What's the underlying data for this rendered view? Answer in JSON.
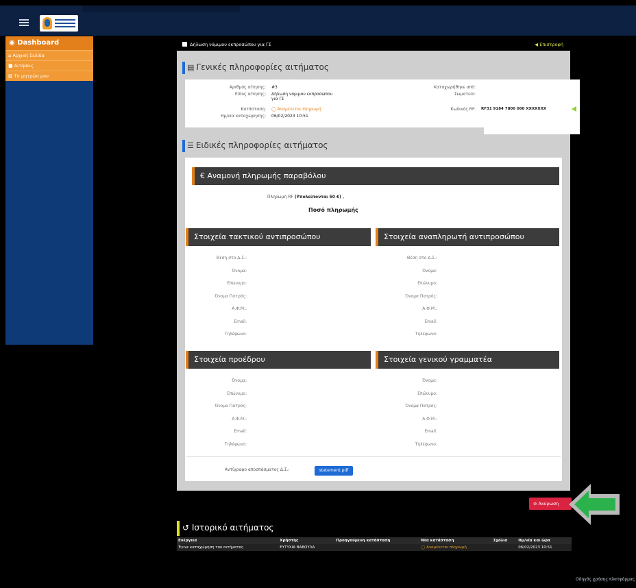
{
  "sidebar": {
    "header": "Dashboard",
    "items": [
      {
        "icon": "home-icon",
        "label": "Αρχική Σελίδα"
      },
      {
        "icon": "folder-icon",
        "label": "Αιτήσεις"
      },
      {
        "icon": "chart-icon",
        "label": "Τα μητρώα μου"
      }
    ]
  },
  "panel": {
    "top_label": "Δήλωση νόμιμου εκπροσώπου για ΓΣ",
    "back_label": "Επιστροφή"
  },
  "general": {
    "title": "Γενικές πληροφορίες αιτήματος",
    "request_no_label": "Αριθμός αίτησης:",
    "request_no": "#3",
    "type_label": "Είδος αίτησης:",
    "type_value": "Δήλωση νόμιμου εκπροσώπου για ΓΣ",
    "status_label": "Κατάσταση:",
    "status_value": "Αναμένεται πληρωμή",
    "date_label": "Ημ/νία καταχώρησης:",
    "date_value": "06/02/2023 10:51",
    "registered_by_label": "Καταχωρήθηκε από:",
    "assoc_label": "Σωματείο:",
    "rf_label": "Κωδικός RF:",
    "rf_value": "RF31 9184 7800 000 XXXXXXX"
  },
  "special": {
    "title": "Ειδικές πληροφορίες αιτήματος",
    "payment_header": "Αναμονή πληρωμής παραβόλου",
    "payment_line_label": "Πληρωμή RF",
    "payment_line_value": "(Υπολείπονται 50 €)",
    "payment_amount_label": "Ποσό πληρωμής",
    "regular_rep_header": "Στοιχεία τακτικού αντιπροσώπου",
    "alt_rep_header": "Στοιχεία αναπληρωτή αντιπροσώπου",
    "president_header": "Στοιχεία προέδρου",
    "secretary_header": "Στοιχεία γενικού γραμματέα",
    "rep_fields": [
      "Θέση στο Δ.Σ.:",
      "Όνομα:",
      "Επώνυμο:",
      "Όνομα Πατρός:",
      "Α.Φ.Μ.:",
      "Email:",
      "Τηλέφωνο:"
    ],
    "officer_fields": [
      "Όνομα:",
      "Επώνυμο:",
      "Όνομα Πατρός:",
      "Α.Φ.Μ.:",
      "Email:",
      "Τηλέφωνο:"
    ],
    "attachment_label": "Αντίγραφο αποσπάσματος Δ.Σ.:",
    "attachment_file": "statement.pdf"
  },
  "cancel_label": "Ακύρωση",
  "history": {
    "title": "Ιστορικό αιτήματος",
    "columns": [
      "Ενέργεια",
      "Χρήστης",
      "Προηγούμενη κατάσταση",
      "Νέα κατάσταση",
      "Σχόλια",
      "Ημ/νία και ώρα"
    ],
    "rows": [
      [
        "Έγινε καταχώρηση του αιτήματος",
        "ΕΥΤΥΧΙΑ ΒΑΒΟΥΛΑ",
        "",
        "Αναμένεται πληρωμή",
        "",
        "06/02/2023 10:51"
      ]
    ]
  },
  "footer_link": "Οδηγός χρήσης πλατφόρμας",
  "colors": {
    "accent": "#1e6bd6",
    "orange": "#e3801c",
    "danger": "#d92340",
    "arrow": "#2bb24c"
  }
}
